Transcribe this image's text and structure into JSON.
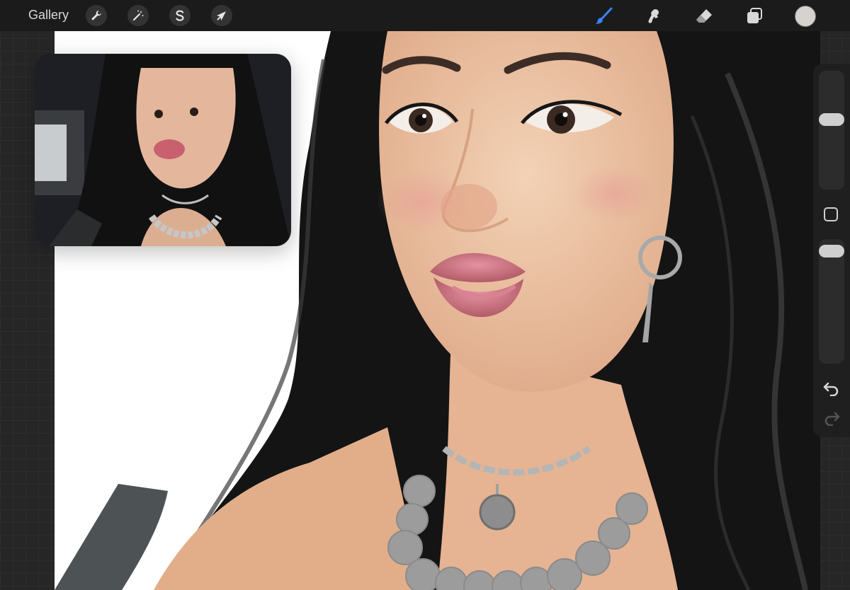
{
  "topbar": {
    "gallery_label": "Gallery",
    "actions_icon": "wrench-icon",
    "adjustments_icon": "magic-wand-icon",
    "selection_icon": "selection-s-icon",
    "transform_icon": "arrow-cursor-icon",
    "brush_icon": "brush-icon",
    "smudge_icon": "smudge-icon",
    "eraser_icon": "eraser-icon",
    "layers_icon": "layers-icon",
    "current_color": "#d6d3cf",
    "active_tool_color": "#3b82f6"
  },
  "sidebar": {
    "brush_size_level": 0.4,
    "opacity_level": 0.05,
    "modify_icon": "square-icon",
    "undo_icon": "undo-icon",
    "redo_icon": "redo-icon"
  },
  "colors": {
    "hair": "#151515",
    "skin": "#ecc3a3",
    "lips": "#c9707b",
    "silver": "#9a9a9a",
    "top": "#4d5255"
  }
}
